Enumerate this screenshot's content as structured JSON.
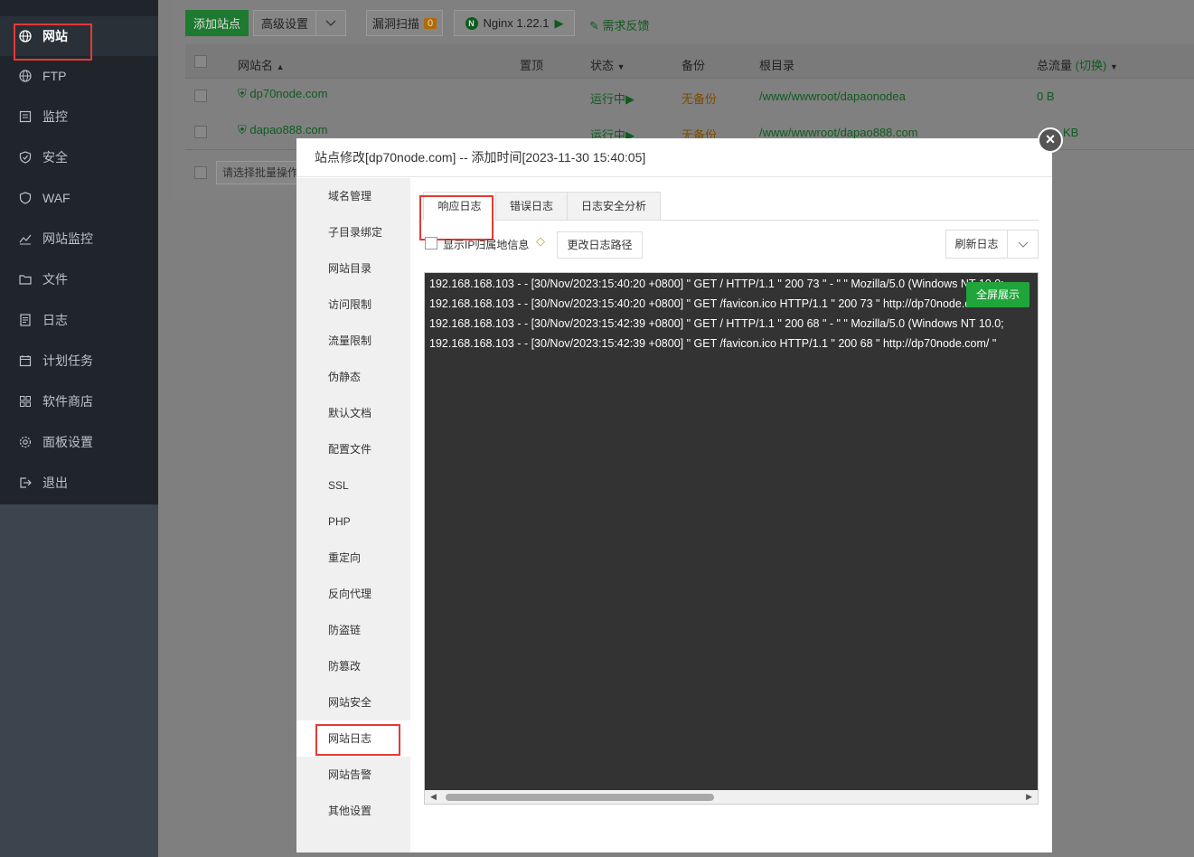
{
  "sidebar": {
    "items": [
      {
        "label": "网站",
        "icon": "globe-icon"
      },
      {
        "label": "FTP",
        "icon": "globe-icon"
      },
      {
        "label": "监控",
        "icon": "chart-icon"
      },
      {
        "label": "安全",
        "icon": "shield-icon"
      },
      {
        "label": "WAF",
        "icon": "waf-shield-icon"
      },
      {
        "label": "网站监控",
        "icon": "line-chart-icon"
      },
      {
        "label": "文件",
        "icon": "folder-icon"
      },
      {
        "label": "日志",
        "icon": "document-icon"
      },
      {
        "label": "计划任务",
        "icon": "calendar-icon"
      },
      {
        "label": "软件商店",
        "icon": "grid-icon"
      },
      {
        "label": "面板设置",
        "icon": "gear-icon"
      },
      {
        "label": "退出",
        "icon": "exit-icon"
      }
    ]
  },
  "toolbar": {
    "add_site": "添加站点",
    "advanced": "高级设置",
    "vuln_scan": "漏洞扫描",
    "vuln_count": "0",
    "nginx": "Nginx 1.22.1",
    "feedback": "需求反馈"
  },
  "table": {
    "headers": {
      "name": "网站名",
      "top": "置顶",
      "status": "状态",
      "backup": "备份",
      "root": "根目录",
      "traffic": "总流量",
      "switch": "(切换)"
    },
    "rows": [
      {
        "name": "dp70node.com",
        "status": "运行中",
        "backup": "无备份",
        "root": "/www/wwwroot/dapaonodea",
        "traffic": "0 B"
      },
      {
        "name": "dapao888.com",
        "status": "运行中",
        "backup": "无备份",
        "root": "/www/wwwroot/dapao888.com",
        "traffic": "KB"
      }
    ],
    "batch_placeholder": "请选择批量操作"
  },
  "modal": {
    "title": "站点修改[dp70node.com] -- 添加时间[2023-11-30 15:40:05]",
    "close": "×",
    "nav": [
      "域名管理",
      "子目录绑定",
      "网站目录",
      "访问限制",
      "流量限制",
      "伪静态",
      "默认文档",
      "配置文件",
      "SSL",
      "PHP",
      "重定向",
      "反向代理",
      "防盗链",
      "防篡改",
      "网站安全",
      "网站日志",
      "网站告警",
      "其他设置"
    ],
    "tabs": [
      "响应日志",
      "错误日志",
      "日志安全分析"
    ],
    "show_ip_label": "显示IP归属地信息",
    "change_path": "更改日志路径",
    "refresh": "刷新日志",
    "fullscreen": "全屏展示",
    "log_lines": [
      "192.168.168.103 - - [30/Nov/2023:15:40:20 +0800]  \" GET / HTTP/1.1 \"  200 73  \" - \"   \" Mozilla/5.0 (Windows NT 10.0;",
      "192.168.168.103 - - [30/Nov/2023:15:40:20 +0800]  \" GET /favicon.ico HTTP/1.1 \"  200 73  \" http://dp70node.com/ \"",
      "192.168.168.103 - - [30/Nov/2023:15:42:39 +0800]  \" GET / HTTP/1.1 \"  200 68  \" - \"   \" Mozilla/5.0 (Windows NT 10.0;",
      "192.168.168.103 - - [30/Nov/2023:15:42:39 +0800]  \" GET /favicon.ico HTTP/1.1 \"  200 68  \" http://dp70node.com/ \""
    ]
  }
}
